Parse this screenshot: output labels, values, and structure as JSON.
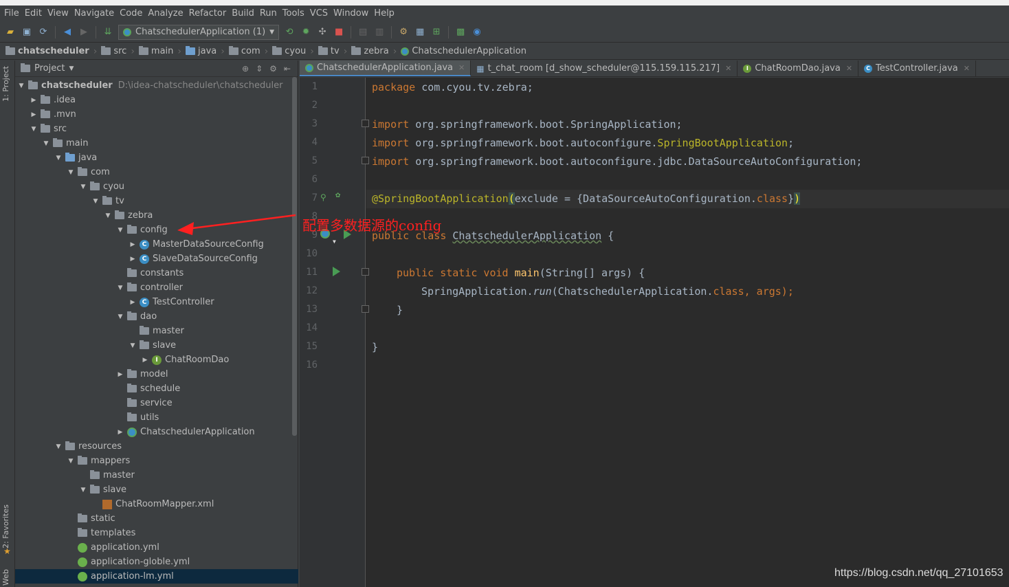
{
  "menu": [
    "File",
    "Edit",
    "View",
    "Navigate",
    "Code",
    "Analyze",
    "Refactor",
    "Build",
    "Run",
    "Tools",
    "VCS",
    "Window",
    "Help"
  ],
  "toolbar": {
    "run_config": "ChatschedulerApplication (1)",
    "icons": [
      "open-icon",
      "save-icon",
      "sync-icon",
      "back-icon",
      "forward-icon",
      "make-icon",
      "run-icon",
      "debug-icon",
      "coverage-icon",
      "stop-icon",
      "structure-icon",
      "settings-icon",
      "sdk-icon",
      "terminal-icon",
      "check-icon"
    ]
  },
  "breadcrumb": [
    "chatscheduler",
    "src",
    "main",
    "java",
    "com",
    "cyou",
    "tv",
    "zebra",
    "ChatschedulerApplication"
  ],
  "sidebar": {
    "project_tab": "1: Project",
    "favorites_tab": "2: Favorites",
    "web_tab": "Web"
  },
  "project": {
    "header": "Project",
    "root_name": "chatscheduler",
    "root_path": "D:\\idea-chatscheduler\\chatscheduler",
    "items": [
      {
        "label": ".idea"
      },
      {
        "label": ".mvn"
      },
      {
        "label": "src"
      },
      {
        "label": "main"
      },
      {
        "label": "java"
      },
      {
        "label": "com"
      },
      {
        "label": "cyou"
      },
      {
        "label": "tv"
      },
      {
        "label": "zebra"
      },
      {
        "label": "config"
      },
      {
        "label": "MasterDataSourceConfig"
      },
      {
        "label": "SlaveDataSourceConfig"
      },
      {
        "label": "constants"
      },
      {
        "label": "controller"
      },
      {
        "label": "TestController"
      },
      {
        "label": "dao"
      },
      {
        "label": "master"
      },
      {
        "label": "slave"
      },
      {
        "label": "ChatRoomDao"
      },
      {
        "label": "model"
      },
      {
        "label": "schedule"
      },
      {
        "label": "service"
      },
      {
        "label": "utils"
      },
      {
        "label": "ChatschedulerApplication"
      },
      {
        "label": "resources"
      },
      {
        "label": "mappers"
      },
      {
        "label": "master"
      },
      {
        "label": "slave"
      },
      {
        "label": "ChatRoomMapper.xml"
      },
      {
        "label": "static"
      },
      {
        "label": "templates"
      },
      {
        "label": "application.yml"
      },
      {
        "label": "application-globle.yml"
      },
      {
        "label": "application-lm.yml"
      }
    ]
  },
  "tabs": [
    {
      "label": "ChatschedulerApplication.java"
    },
    {
      "label": "t_chat_room [d_show_scheduler@115.159.115.217]"
    },
    {
      "label": "ChatRoomDao.java"
    },
    {
      "label": "TestController.java"
    }
  ],
  "editor": {
    "line_numbers": [
      "1",
      "2",
      "3",
      "4",
      "5",
      "6",
      "7",
      "8",
      "9",
      "10",
      "11",
      "12",
      "13",
      "14",
      "15",
      "16"
    ],
    "code": {
      "l1_kw": "package",
      "l1_rest": " com.cyou.tv.zebra;",
      "l3_kw": "import",
      "l3_rest": " org.springframework.boot.SpringApplication;",
      "l4_kw": "import",
      "l4_pre": " org.springframework.boot.autoconfigure.",
      "l4_ann": "SpringBootApplication",
      "l4_end": ";",
      "l5_kw": "import",
      "l5_rest": " org.springframework.boot.autoconfigure.jdbc.DataSourceAutoConfiguration;",
      "l7_ann": "@SpringBootApplication",
      "l7_p1": "(",
      "l7_mid": "exclude = {DataSourceAutoConfiguration.",
      "l7_cls": "class",
      "l7_end": "}",
      "l7_p2": ")",
      "l9_kw": "public class",
      "l9_name": "ChatschedulerApplication",
      "l9_end": " {",
      "l11_kw": "public static void",
      "l11_fn": "main",
      "l11_rest": "(String[] args) {",
      "l12_pre": "SpringApplication.",
      "l12_it": "run",
      "l12_mid": "(ChatschedulerApplication.",
      "l12_cls": "class",
      "l12_end": ", args);",
      "l13": "}",
      "l15": "}"
    }
  },
  "annotation": "配置多数据源的config",
  "watermark": "https://blog.csdn.net/qq_27101653",
  "colors": {
    "background": "#2b2b2b",
    "keyword": "#cc7832",
    "annotation": "#bbb529",
    "arrow": "#ff2020"
  }
}
